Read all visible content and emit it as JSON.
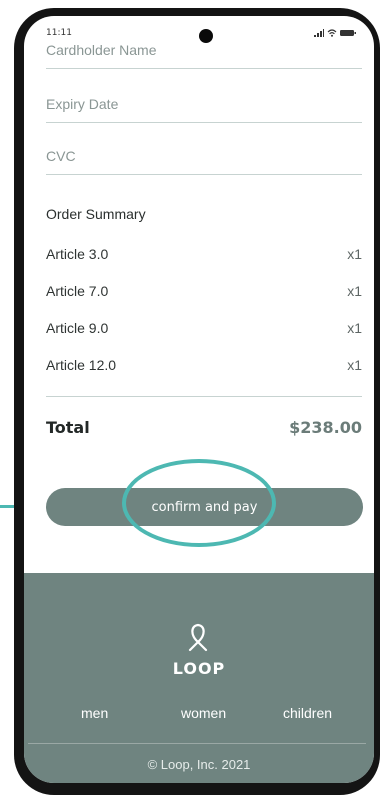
{
  "status_bar": {
    "time": "11:11"
  },
  "form": {
    "cardholder_placeholder": "Cardholder Name",
    "expiry_placeholder": "Expiry Date",
    "cvc_placeholder": "CVC"
  },
  "order_summary": {
    "title": "Order Summary",
    "items": [
      {
        "name": "Article 3.0",
        "qty": "x1"
      },
      {
        "name": "Article 7.0",
        "qty": "x1"
      },
      {
        "name": "Article 9.0",
        "qty": "x1"
      },
      {
        "name": "Article 12.0",
        "qty": "x1"
      }
    ],
    "total_label": "Total",
    "total_value": "$238.00"
  },
  "pay_button": {
    "label": "confirm and pay"
  },
  "footer": {
    "logo_text": "LOOP",
    "nav": [
      "men",
      "women",
      "children"
    ],
    "copyright": "© Loop, Inc. 2021"
  },
  "colors": {
    "accent": "#6f8480",
    "highlight": "#4db8b2"
  },
  "icons": [
    "signal-icon",
    "wifi-icon",
    "battery-icon",
    "loop-logo-icon"
  ]
}
